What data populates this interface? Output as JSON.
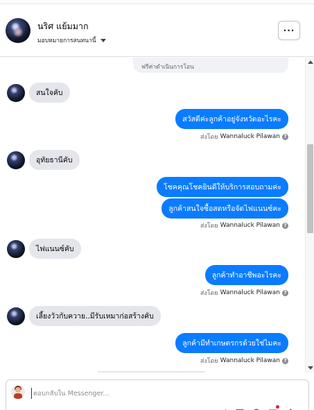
{
  "header": {
    "contact_name": "นริศ แย้มมาก",
    "assign_label": "มอบหมายการสนทนานี้",
    "more_label": "···"
  },
  "conversation": {
    "system_banner": "ฟรีค่าดำเนินการโอน",
    "customer_messages": [
      "สนใจคับ",
      "อุทัยธานีคับ",
      "ไฟแนนซ์คับ",
      "เลี้ยงวัวกับควาย..มีรับเหมาก่อสร้างคับ"
    ],
    "agent_messages": [
      "สวัสดีค่ะลูกค้าอยู่จังหวัดอะไรคะ",
      "โชคคุณโชคยินดีให้บริการสอบถามค่ะ",
      "ลูกค้าสนใจซื้อสดหรือจัดไฟแนนซ์คะ",
      "ลูกค้าทำอาชีพอะไรคะ",
      "ลูกค้ามีทำเกษตรกรด้วยใช่ไมคะ"
    ],
    "sent_by_prefix": "ส่งโดย",
    "agent_name": "Wannaluck Pilawan",
    "help_glyph": "?"
  },
  "composer": {
    "placeholder": "ตอบกลับใน Messenger..."
  },
  "icons": {
    "more": "more-horizontal-icon",
    "attach": "paperclip-icon",
    "gif": "gif-icon",
    "emoji": "emoji-icon",
    "saved_reply": "saved-reply-icon",
    "like": "thumbs-up-icon"
  },
  "colors": {
    "accent": "#0a7cff",
    "incoming_bubble": "#e4e6eb",
    "notification_dot": "#e41e3f"
  }
}
